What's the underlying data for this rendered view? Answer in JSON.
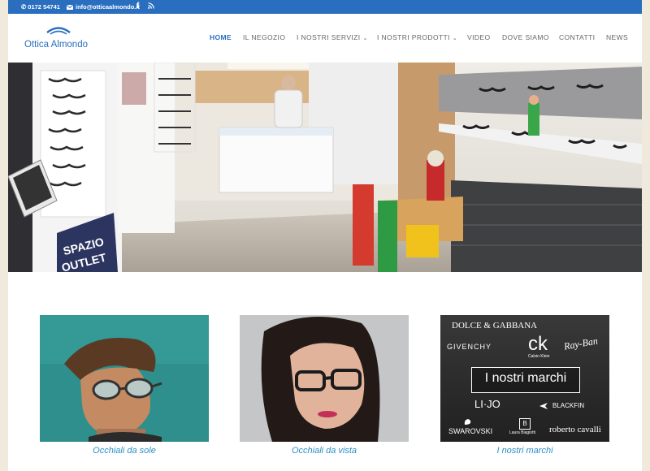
{
  "topbar": {
    "phone": "0172 54741",
    "email": "info@otticaalmondo.it",
    "bg_color": "#2a6fbf"
  },
  "header": {
    "brand": "Ottica Almondo",
    "brand_color": "#2a6fbf"
  },
  "nav": {
    "items": [
      {
        "label": "HOME",
        "active": true
      },
      {
        "label": "IL NEGOZIO"
      },
      {
        "label": "I NOSTRI SERVIZI",
        "dropdown": true
      },
      {
        "label": "I NOSTRI PRODOTTI",
        "dropdown": true
      },
      {
        "label": "VIDEO"
      },
      {
        "label": "DOVE SIAMO"
      },
      {
        "label": "CONTATTI"
      },
      {
        "label": "NEWS"
      }
    ]
  },
  "hero": {
    "sign_line1": "SPAZIO",
    "sign_line2": "OUTLET"
  },
  "cards": [
    {
      "caption": "Occhiali da sole"
    },
    {
      "caption": "Occhiali da vista"
    },
    {
      "caption": "I nostri marchi",
      "center_text": "I nostri marchi",
      "brands": {
        "dg": "DOLCE & GABBANA",
        "givenchy": "GIVENCHY",
        "ck": "ck",
        "ck_sub": "Calvin Klein",
        "rayban": "Ray-Ban",
        "lijo": "LI·JO",
        "blackfin": "BLACKFIN",
        "swarovski": "SWAROVSKI",
        "laura": "Laura Biagiotti",
        "cavalli": "roberto cavalli"
      }
    }
  ]
}
